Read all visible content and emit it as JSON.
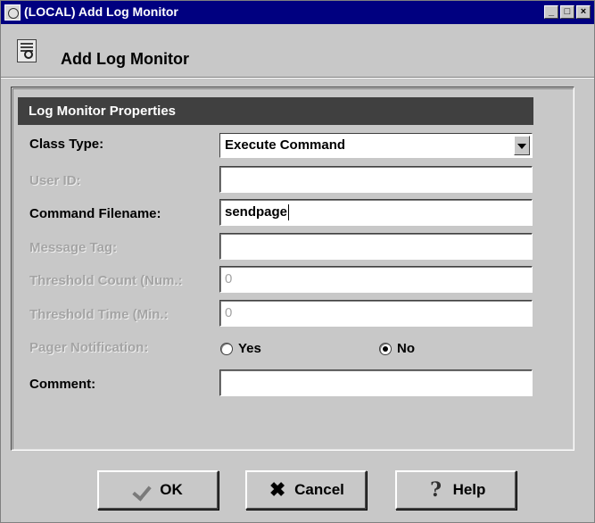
{
  "window": {
    "title": "(LOCAL) Add Log Monitor",
    "controls": {
      "minimize": "_",
      "maximize": "□",
      "close": "×"
    }
  },
  "header": {
    "title": "Add Log Monitor",
    "icon": "log-document-icon"
  },
  "section": {
    "title": "Log Monitor Properties"
  },
  "form": {
    "class_type": {
      "label": "Class Type:",
      "value": "Execute Command"
    },
    "user_id": {
      "label": "User ID:",
      "value": ""
    },
    "command_filename": {
      "label": "Command Filename:",
      "value": "sendpage"
    },
    "message_tag": {
      "label": "Message Tag:",
      "value": ""
    },
    "threshold_count": {
      "label": "Threshold Count (Num.:",
      "value": "0"
    },
    "threshold_time": {
      "label": "Threshold Time (Min.:",
      "value": "0"
    },
    "pager_notification": {
      "label": "Pager Notification:",
      "yes_label": "Yes",
      "no_label": "No",
      "selected": "No"
    },
    "comment": {
      "label": "Comment:",
      "value": ""
    }
  },
  "buttons": {
    "ok": {
      "label": "OK",
      "icon": "check-icon"
    },
    "cancel": {
      "label": "Cancel",
      "icon": "x-icon"
    },
    "help": {
      "label": "Help",
      "icon": "help-icon"
    }
  },
  "colors": {
    "titlebar": "#000080",
    "window_bg": "#c8c8c8",
    "section_header": "#404040",
    "disabled_text": "#a4a4a4"
  }
}
